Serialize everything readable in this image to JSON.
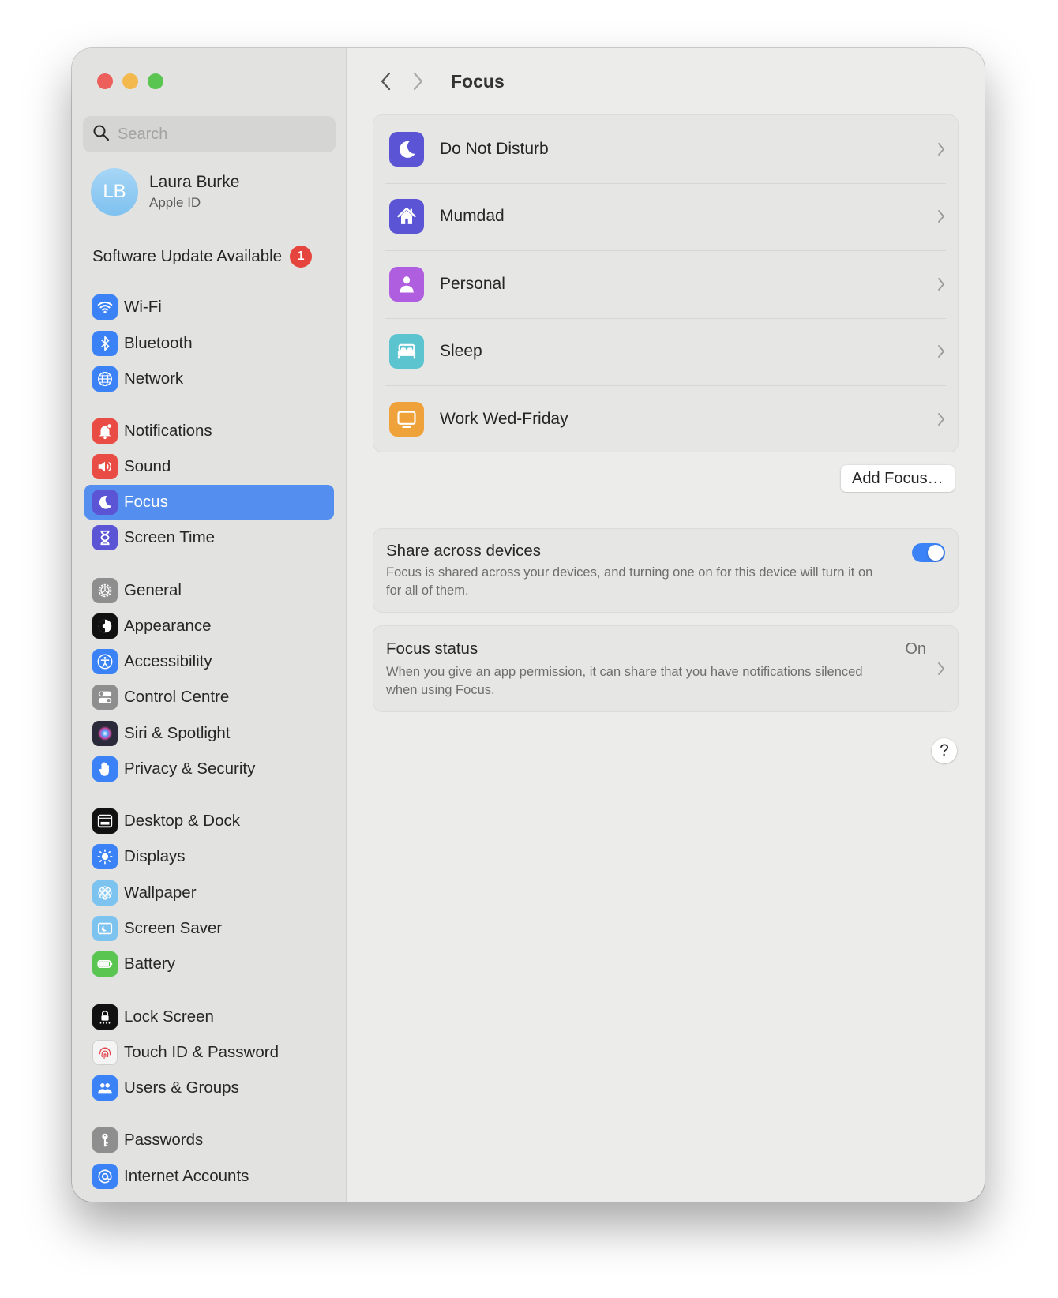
{
  "window": {
    "controls": [
      "close",
      "minimize",
      "maximize"
    ]
  },
  "sidebar": {
    "search": {
      "placeholder": "Search",
      "value": "",
      "icon": "search-icon"
    },
    "account": {
      "initials": "LB",
      "name": "Laura Burke",
      "subtitle": "Apple ID"
    },
    "update": {
      "label": "Software Update Available",
      "badge": "1"
    },
    "items": [
      {
        "id": "wifi",
        "label": "Wi-Fi",
        "icon": "wifi-icon",
        "color": "#3b82f6"
      },
      {
        "id": "bluetooth",
        "label": "Bluetooth",
        "icon": "bluetooth-icon",
        "color": "#3b82f6"
      },
      {
        "id": "network",
        "label": "Network",
        "icon": "globe-icon",
        "color": "#3b82f6"
      },
      {
        "id": "notifications",
        "label": "Notifications",
        "icon": "bell-icon",
        "color": "#e84c45"
      },
      {
        "id": "sound",
        "label": "Sound",
        "icon": "speaker-icon",
        "color": "#e84c45"
      },
      {
        "id": "focus",
        "label": "Focus",
        "icon": "moon-icon",
        "color": "#5b55d6",
        "active": true
      },
      {
        "id": "screen-time",
        "label": "Screen Time",
        "icon": "hourglass-icon",
        "color": "#5b55d6"
      },
      {
        "id": "general",
        "label": "General",
        "icon": "gear-icon",
        "color": "#8e8e8e"
      },
      {
        "id": "appearance",
        "label": "Appearance",
        "icon": "appearance-icon",
        "color": "#111111"
      },
      {
        "id": "accessibility",
        "label": "Accessibility",
        "icon": "accessibility-icon",
        "color": "#3b82f6"
      },
      {
        "id": "control-centre",
        "label": "Control Centre",
        "icon": "toggles-icon",
        "color": "#8e8e8e"
      },
      {
        "id": "siri-spotlight",
        "label": "Siri & Spotlight",
        "icon": "siri-icon",
        "color": "#2a2a3a"
      },
      {
        "id": "privacy-security",
        "label": "Privacy & Security",
        "icon": "hand-icon",
        "color": "#3b82f6"
      },
      {
        "id": "desktop-dock",
        "label": "Desktop & Dock",
        "icon": "dock-icon",
        "color": "#111111"
      },
      {
        "id": "displays",
        "label": "Displays",
        "icon": "sun-icon",
        "color": "#3b82f6"
      },
      {
        "id": "wallpaper",
        "label": "Wallpaper",
        "icon": "flower-icon",
        "color": "#7cc3f0"
      },
      {
        "id": "screen-saver",
        "label": "Screen Saver",
        "icon": "screensaver-icon",
        "color": "#7cc3f0"
      },
      {
        "id": "battery",
        "label": "Battery",
        "icon": "battery-icon",
        "color": "#5bc552"
      },
      {
        "id": "lock-screen",
        "label": "Lock Screen",
        "icon": "lock-icon",
        "color": "#111111"
      },
      {
        "id": "touch-id",
        "label": "Touch ID & Password",
        "icon": "fingerprint-icon",
        "color": "#f4f4f4"
      },
      {
        "id": "users-groups",
        "label": "Users & Groups",
        "icon": "users-icon",
        "color": "#3b82f6"
      },
      {
        "id": "passwords",
        "label": "Passwords",
        "icon": "key-icon",
        "color": "#8e8e8e"
      },
      {
        "id": "internet-accounts",
        "label": "Internet Accounts",
        "icon": "at-icon",
        "color": "#3b82f6"
      }
    ]
  },
  "main": {
    "title": "Focus",
    "focus_modes": [
      {
        "label": "Do Not Disturb",
        "icon": "moon-icon",
        "color": "#5b55d6"
      },
      {
        "label": "Mumdad",
        "icon": "house-icon",
        "color": "#5b55d6"
      },
      {
        "label": "Personal",
        "icon": "person-icon",
        "color": "#b05ee0"
      },
      {
        "label": "Sleep",
        "icon": "bed-icon",
        "color": "#5cc4cf"
      },
      {
        "label": "Work Wed-Friday",
        "icon": "monitor-icon",
        "color": "#f0a23a"
      }
    ],
    "add_focus_label": "Add Focus…",
    "share": {
      "title": "Share across devices",
      "description": "Focus is shared across your devices, and turning one on for this device will turn it on for all of them.",
      "enabled": true
    },
    "status": {
      "title": "Focus status",
      "value": "On",
      "description": "When you give an app permission, it can share that you have notifications silenced when using Focus."
    },
    "help_label": "?"
  },
  "colors": {
    "accent": "#548ff0",
    "toggle": "#3b82f6"
  }
}
